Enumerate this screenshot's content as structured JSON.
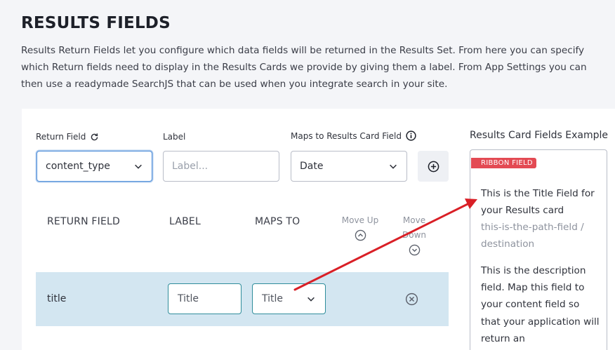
{
  "header": {
    "title": "RESULTS FIELDS",
    "description": "Results Return Fields let you configure which data fields will be returned in the Results Set. From here you can specify which Return fields need to display in the Results Cards we provide by giving them a label. From App Settings you can then use a readymade SearchJS that can be used when you integrate search in your site."
  },
  "form": {
    "return_field_label": "Return Field",
    "return_field_value": "content_type",
    "label_label": "Label",
    "label_placeholder": "Label...",
    "maps_label": "Maps to Results Card Field",
    "maps_value": "Date",
    "icons": {
      "refresh": "refresh-icon",
      "info": "info-icon",
      "add": "plus-circle-icon",
      "dropdown": "chevron-down-icon"
    }
  },
  "table": {
    "headers": {
      "return_field": "RETURN FIELD",
      "label": "LABEL",
      "maps_to": "MAPS TO",
      "move_up": "Move Up",
      "move_down": "Move Down"
    },
    "rows": [
      {
        "return_field": "title",
        "label": "Title",
        "maps_to": "Title"
      }
    ]
  },
  "preview": {
    "heading": "Results Card Fields Example",
    "ribbon": "RIBBON FIELD",
    "title_field": "This is the Title Field for your Results card",
    "path_field": "this-is-the-path-field / destination",
    "description_field": "This is the description field. Map this field to your content field so that your application will return an"
  },
  "colors": {
    "row_highlight": "#d3e6f1",
    "ribbon": "#e34a53",
    "focus_border": "#4f8ed9",
    "arrow": "#d91f26"
  }
}
